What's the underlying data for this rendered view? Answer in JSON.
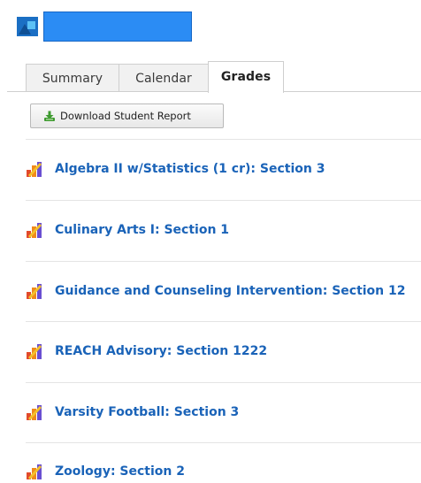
{
  "header": {
    "brand_color": "#1b6fc4",
    "redacted_name_color": "#2b8cf4"
  },
  "tabs": [
    {
      "label": "Summary",
      "active": false
    },
    {
      "label": "Calendar",
      "active": false
    },
    {
      "label": "Grades",
      "active": true
    }
  ],
  "toolbar": {
    "download_label": "Download Student Report",
    "download_icon": "download-icon"
  },
  "courses": [
    {
      "label": "Algebra II w/Statistics (1 cr): Section 3",
      "icon": "grades-chart-icon"
    },
    {
      "label": "Culinary Arts I: Section 1",
      "icon": "grades-chart-icon"
    },
    {
      "label": "Guidance and Counseling Intervention: Section 12",
      "icon": "grades-chart-icon"
    },
    {
      "label": "REACH Advisory: Section 1222",
      "icon": "grades-chart-icon"
    },
    {
      "label": "Varsity Football: Section 3",
      "icon": "grades-chart-icon"
    },
    {
      "label": "Zoology: Section 2",
      "icon": "grades-chart-icon"
    }
  ],
  "colors": {
    "link": "#1a63b8",
    "tab_inactive_bg": "#f1f1f1",
    "divider": "#e4e4e4"
  }
}
